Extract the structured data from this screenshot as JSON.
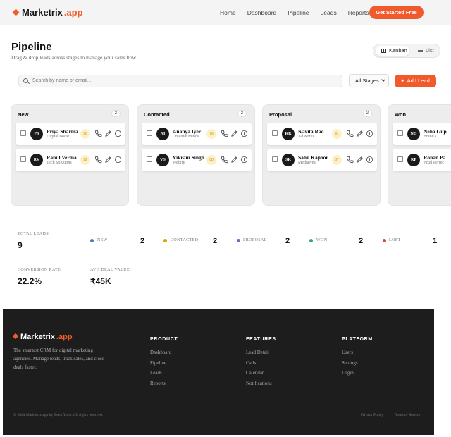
{
  "nav": {
    "brand": "Marketrix",
    "brand_suffix": ".app",
    "links": [
      "Home",
      "Dashboard",
      "Pipeline",
      "Leads",
      "Reports"
    ],
    "cta": "Get Started Free",
    "accent_color": "#f15a2b"
  },
  "header": {
    "title": "Pipeline",
    "subtitle": "Drag & drop leads across stages to manage your sales flow.",
    "views": [
      "Kanban",
      "List"
    ],
    "active_view": "Kanban"
  },
  "toolbar": {
    "search_placeholder": "Search by name or email...",
    "stage_filter": "All Stages",
    "add_lead": "Add Lead"
  },
  "columns": [
    {
      "title": "New",
      "count": "2",
      "cards": [
        {
          "initials": "PS",
          "name": "Priya Sharma",
          "company": "Digital Boost",
          "score": "96"
        },
        {
          "initials": "RV",
          "name": "Rahul Verma",
          "company": "Tech Solutions",
          "score": "92"
        }
      ]
    },
    {
      "title": "Contacted",
      "count": "2",
      "cards": [
        {
          "initials": "AI",
          "name": "Ananya Iyer",
          "company": "Creative Minds",
          "score": "76"
        },
        {
          "initials": "VS",
          "name": "Vikram Singh",
          "company": "Webify",
          "score": "88"
        }
      ]
    },
    {
      "title": "Proposal",
      "count": "2",
      "cards": [
        {
          "initials": "KR",
          "name": "Kavita Rao",
          "company": "AdWorks",
          "score": "91"
        },
        {
          "initials": "SK",
          "name": "Sahil Kapoor",
          "company": "MediaNest",
          "score": "87"
        }
      ]
    },
    {
      "title": "Won",
      "count": "",
      "cards": [
        {
          "initials": "NG",
          "name": "Neha Gup",
          "company": "BrandX",
          "score": ""
        },
        {
          "initials": "RP",
          "name": "Rohan Pa",
          "company": "Pixel Perfec",
          "score": ""
        }
      ]
    }
  ],
  "stats": {
    "total_label": "TOTAL LEADS",
    "total_value": "9",
    "stages": [
      {
        "label": "NEW",
        "value": "2",
        "color": "#3b82c4"
      },
      {
        "label": "CONTACTED",
        "value": "2",
        "color": "#e0a400"
      },
      {
        "label": "PROPOSAL",
        "value": "2",
        "color": "#8a5cd0"
      },
      {
        "label": "WON",
        "value": "2",
        "color": "#2ea87a"
      },
      {
        "label": "LOST",
        "value": "1",
        "color": "#d9443a"
      }
    ],
    "conversion_label": "CONVERSION RATE",
    "conversion_value": "22.2%",
    "deal_label": "AVG DEAL VALUE",
    "deal_value": "₹45K"
  },
  "footer": {
    "brand": "Marketrix",
    "brand_suffix": ".app",
    "description": "The smartest CRM for digital marketing agencies. Manage leads, track sales, and close deals faster.",
    "columns": [
      {
        "title": "PRODUCT",
        "links": [
          "Dashboard",
          "Pipeline",
          "Leads",
          "Reports"
        ]
      },
      {
        "title": "FEATURES",
        "links": [
          "Lead Detail",
          "Calls",
          "Calendar",
          "Notifications"
        ]
      },
      {
        "title": "PLATFORM",
        "links": [
          "Users",
          "Settings",
          "Login"
        ]
      }
    ],
    "copyright": "© 2024 Marketrix.app by Team Yoon. All rights reserved.",
    "legal": [
      "Privacy Policy",
      "Terms of Service"
    ]
  }
}
